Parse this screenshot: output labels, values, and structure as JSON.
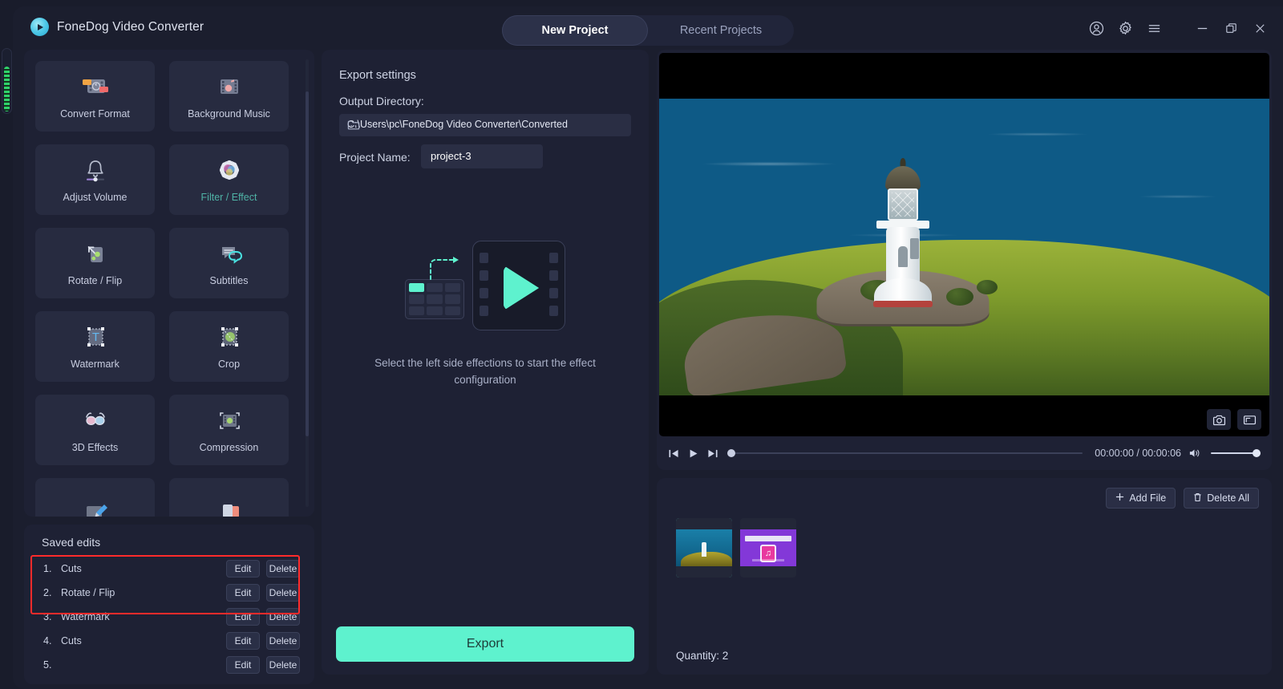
{
  "app": {
    "title": "FoneDog Video Converter",
    "logo_icon": "play-circle-logo"
  },
  "titlebar": {
    "tabs": [
      {
        "label": "New Project",
        "active": true
      },
      {
        "label": "Recent Projects",
        "active": false
      }
    ],
    "icons": [
      {
        "name": "account-icon"
      },
      {
        "name": "gear-icon"
      },
      {
        "name": "menu-icon"
      },
      {
        "name": "minimize-icon"
      },
      {
        "name": "maximize-icon"
      },
      {
        "name": "close-icon"
      }
    ]
  },
  "tools": {
    "items": [
      {
        "label": "Convert Format",
        "icon": "convert-format-icon",
        "active": false
      },
      {
        "label": "Background Music",
        "icon": "background-music-icon",
        "active": false
      },
      {
        "label": "Adjust Volume",
        "icon": "adjust-volume-icon",
        "active": false
      },
      {
        "label": "Filter / Effect",
        "icon": "filter-effect-icon",
        "active": true
      },
      {
        "label": "Rotate / Flip",
        "icon": "rotate-flip-icon",
        "active": false
      },
      {
        "label": "Subtitles",
        "icon": "subtitles-icon",
        "active": false
      },
      {
        "label": "Watermark",
        "icon": "watermark-icon",
        "active": false
      },
      {
        "label": "Crop",
        "icon": "crop-icon",
        "active": false
      },
      {
        "label": "3D Effects",
        "icon": "3d-effects-icon",
        "active": false
      },
      {
        "label": "Compression",
        "icon": "compression-icon",
        "active": false
      },
      {
        "label": "",
        "icon": "enhance-icon",
        "active": false
      },
      {
        "label": "",
        "icon": "merge-icon",
        "active": false
      }
    ],
    "accent_color": "#4fb3a6"
  },
  "saved_edits": {
    "title": "Saved edits",
    "edit_label": "Edit",
    "delete_label": "Delete",
    "highlight_color": "#ff2b2b",
    "rows": [
      {
        "num": "1.",
        "name": "Cuts"
      },
      {
        "num": "2.",
        "name": "Rotate / Flip"
      },
      {
        "num": "3.",
        "name": "Watermark"
      },
      {
        "num": "4.",
        "name": "Cuts"
      },
      {
        "num": "5.",
        "name": ""
      }
    ]
  },
  "export": {
    "heading": "Export settings",
    "output_dir_label": "Output Directory:",
    "output_dir_value": "C:\\Users\\pc\\FoneDog Video Converter\\Converted",
    "folder_icon": "folder-icon",
    "project_name_label": "Project Name:",
    "project_name_value": "project-3",
    "placeholder_text": "Select the left side effections to start the effect configuration",
    "placeholder_icon": "effect-placeholder-illustration",
    "export_button": "Export",
    "export_color": "#5ef2ce"
  },
  "player": {
    "snapshot_icon": "camera-icon",
    "fullscreen_icon": "fullscreen-icon",
    "prev_icon": "previous-frame-icon",
    "play_icon": "play-icon",
    "next_icon": "next-frame-icon",
    "volume_icon": "volume-icon",
    "current_time": "00:00:00",
    "total_time": "00:00:06",
    "time_display": "00:00:00 / 00:00:06",
    "progress_percent": 0,
    "volume_percent": 100
  },
  "files": {
    "add_file_label": "Add File",
    "add_file_icon": "plus-icon",
    "delete_all_label": "Delete All",
    "delete_all_icon": "trash-icon",
    "quantity_label": "Quantity: 2",
    "thumbnails": [
      {
        "name": "lighthouse-video-thumb",
        "selected": true
      },
      {
        "name": "audio-file-thumb",
        "selected": false,
        "icon": "music-note-icon"
      }
    ]
  }
}
